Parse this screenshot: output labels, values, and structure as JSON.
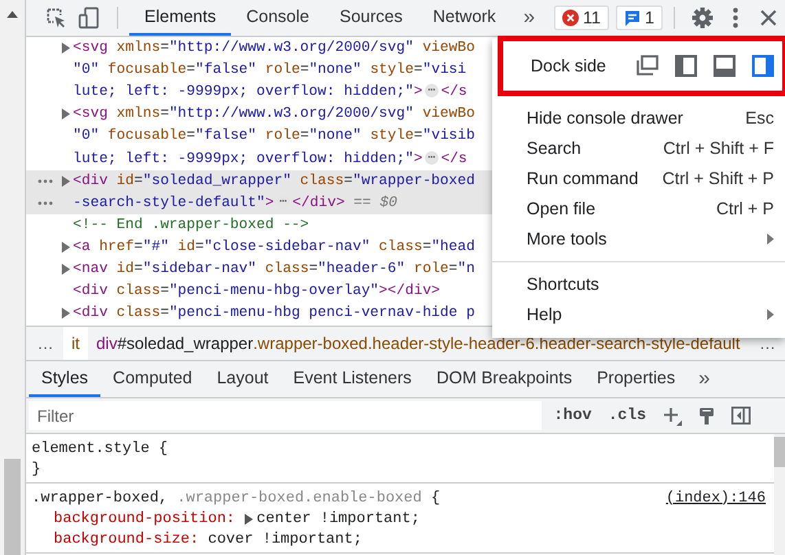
{
  "toolbar": {
    "tabs": [
      {
        "label": "Elements",
        "selected": true
      },
      {
        "label": "Console",
        "selected": false
      },
      {
        "label": "Sources",
        "selected": false
      },
      {
        "label": "Network",
        "selected": false
      }
    ],
    "overflow": "»",
    "errors": "11",
    "messages": "1"
  },
  "elements": {
    "lines": [
      {
        "expandable": true,
        "selected": false,
        "segments": [
          {
            "kind": "tag",
            "text": "<svg"
          },
          {
            "kind": "attr",
            "text": " xmlns"
          },
          {
            "kind": "punct",
            "text": "="
          },
          {
            "kind": "value",
            "text": "\"http://www.w3.org/2000/svg\""
          },
          {
            "kind": "attr",
            "text": " viewBo"
          }
        ]
      },
      {
        "expandable": false,
        "selected": false,
        "segments": [
          {
            "kind": "value",
            "text": "\"0\""
          },
          {
            "kind": "attr",
            "text": " focusable"
          },
          {
            "kind": "punct",
            "text": "="
          },
          {
            "kind": "value",
            "text": "\"false\""
          },
          {
            "kind": "attr",
            "text": " role"
          },
          {
            "kind": "punct",
            "text": "="
          },
          {
            "kind": "value",
            "text": "\"none\""
          },
          {
            "kind": "attr",
            "text": " style"
          },
          {
            "kind": "punct",
            "text": "="
          },
          {
            "kind": "value",
            "text": "\"visi"
          }
        ]
      },
      {
        "expandable": false,
        "selected": false,
        "segments": [
          {
            "kind": "value",
            "text": "lute; left: -9999px; overflow: hidden;\""
          },
          {
            "kind": "tag",
            "text": ">"
          },
          {
            "kind": "dots",
            "text": "⋯"
          },
          {
            "kind": "tag",
            "text": "</s"
          }
        ]
      },
      {
        "expandable": true,
        "selected": false,
        "segments": [
          {
            "kind": "tag",
            "text": "<svg"
          },
          {
            "kind": "attr",
            "text": " xmlns"
          },
          {
            "kind": "punct",
            "text": "="
          },
          {
            "kind": "value",
            "text": "\"http://www.w3.org/2000/svg\""
          },
          {
            "kind": "attr",
            "text": " viewBo"
          }
        ]
      },
      {
        "expandable": false,
        "selected": false,
        "segments": [
          {
            "kind": "value",
            "text": "\"0\""
          },
          {
            "kind": "attr",
            "text": " focusable"
          },
          {
            "kind": "punct",
            "text": "="
          },
          {
            "kind": "value",
            "text": "\"false\""
          },
          {
            "kind": "attr",
            "text": " role"
          },
          {
            "kind": "punct",
            "text": "="
          },
          {
            "kind": "value",
            "text": "\"none\""
          },
          {
            "kind": "attr",
            "text": " style"
          },
          {
            "kind": "punct",
            "text": "="
          },
          {
            "kind": "value",
            "text": "\"visib"
          }
        ]
      },
      {
        "expandable": false,
        "selected": false,
        "segments": [
          {
            "kind": "value",
            "text": "lute; left: -9999px; overflow: hidden;\""
          },
          {
            "kind": "tag",
            "text": ">"
          },
          {
            "kind": "dots",
            "text": "⋯"
          },
          {
            "kind": "tag",
            "text": "</s"
          }
        ]
      },
      {
        "expandable": true,
        "selected": true,
        "segments": [
          {
            "kind": "tag",
            "text": "<div"
          },
          {
            "kind": "attr",
            "text": " id"
          },
          {
            "kind": "punct",
            "text": "="
          },
          {
            "kind": "value",
            "text": "\"soledad_wrapper\""
          },
          {
            "kind": "attr",
            "text": " class"
          },
          {
            "kind": "punct",
            "text": "="
          },
          {
            "kind": "value",
            "text": "\"wrapper-boxed"
          }
        ]
      },
      {
        "expandable": false,
        "selected": true,
        "segments": [
          {
            "kind": "value",
            "text": "-search-style-default\""
          },
          {
            "kind": "tag",
            "text": ">"
          },
          {
            "kind": "dots",
            "text": "⋯"
          },
          {
            "kind": "tag",
            "text": "</div>"
          },
          {
            "kind": "note",
            "text": " == $0"
          }
        ]
      },
      {
        "expandable": false,
        "selected": false,
        "segments": [
          {
            "kind": "comment",
            "text": "<!-- End .wrapper-boxed -->"
          }
        ]
      },
      {
        "expandable": true,
        "selected": false,
        "segments": [
          {
            "kind": "tag",
            "text": "<a"
          },
          {
            "kind": "attr",
            "text": " href"
          },
          {
            "kind": "punct",
            "text": "="
          },
          {
            "kind": "value",
            "text": "\"#\""
          },
          {
            "kind": "attr",
            "text": " id"
          },
          {
            "kind": "punct",
            "text": "="
          },
          {
            "kind": "value",
            "text": "\"close-sidebar-nav\""
          },
          {
            "kind": "attr",
            "text": " class"
          },
          {
            "kind": "punct",
            "text": "="
          },
          {
            "kind": "value",
            "text": "\"head"
          }
        ]
      },
      {
        "expandable": true,
        "selected": false,
        "segments": [
          {
            "kind": "tag",
            "text": "<nav"
          },
          {
            "kind": "attr",
            "text": " id"
          },
          {
            "kind": "punct",
            "text": "="
          },
          {
            "kind": "value",
            "text": "\"sidebar-nav\""
          },
          {
            "kind": "attr",
            "text": " class"
          },
          {
            "kind": "punct",
            "text": "="
          },
          {
            "kind": "value",
            "text": "\"header-6\""
          },
          {
            "kind": "attr",
            "text": " role"
          },
          {
            "kind": "punct",
            "text": "="
          },
          {
            "kind": "value",
            "text": "\"n"
          }
        ]
      },
      {
        "expandable": false,
        "selected": false,
        "segments": [
          {
            "kind": "tag",
            "text": "<div"
          },
          {
            "kind": "attr",
            "text": " class"
          },
          {
            "kind": "punct",
            "text": "="
          },
          {
            "kind": "value",
            "text": "\"penci-menu-hbg-overlay\""
          },
          {
            "kind": "tag",
            "text": "></div>"
          }
        ]
      },
      {
        "expandable": true,
        "selected": false,
        "segments": [
          {
            "kind": "tag",
            "text": "<div"
          },
          {
            "kind": "attr",
            "text": " class"
          },
          {
            "kind": "punct",
            "text": "="
          },
          {
            "kind": "value",
            "text": "\"penci-menu-hbg penci-vernav-hide p"
          }
        ]
      }
    ]
  },
  "breadcrumbs": {
    "left": "…",
    "crumbs": [
      {
        "selected": true,
        "segments": [
          {
            "kind": "class",
            "text": "it"
          }
        ]
      },
      {
        "selected": false,
        "segments": [
          {
            "kind": "tag",
            "text": "div"
          },
          {
            "kind": "id",
            "text": "#soledad_wrapper"
          },
          {
            "kind": "class",
            "text": ".wrapper-boxed.header-style-header-6.header-search-style-default"
          }
        ]
      }
    ],
    "right": "…"
  },
  "sidebar_tabs": {
    "tabs": [
      {
        "label": "Styles",
        "selected": true
      },
      {
        "label": "Computed",
        "selected": false
      },
      {
        "label": "Layout",
        "selected": false
      },
      {
        "label": "Event Listeners",
        "selected": false
      },
      {
        "label": "DOM Breakpoints",
        "selected": false
      },
      {
        "label": "Properties",
        "selected": false
      }
    ],
    "overflow": "»"
  },
  "filter": {
    "placeholder": "Filter",
    "toggles": [
      ":hov",
      ".cls"
    ]
  },
  "styles": {
    "rules": [
      {
        "selector": [
          {
            "text": "element.style",
            "matched": true
          }
        ],
        "open": " {",
        "close": "}"
      },
      {
        "selector": [
          {
            "text": ".wrapper-boxed,",
            "matched": true
          },
          {
            "text": " .wrapper-boxed.enable-boxed",
            "matched": false
          }
        ],
        "open": " {",
        "source": "(index):146",
        "properties": [
          {
            "name": "background-position:",
            "value": "center !important;",
            "expandable": true
          },
          {
            "name": "background-size:",
            "value": "cover !important;",
            "expandable": false
          }
        ]
      }
    ]
  },
  "menu": {
    "dock_side": {
      "label": "Dock side",
      "options": [
        {
          "kind": "undock",
          "selected": false
        },
        {
          "kind": "left",
          "selected": false
        },
        {
          "kind": "bottom",
          "selected": false
        },
        {
          "kind": "right",
          "selected": true
        }
      ]
    },
    "groups": [
      [
        {
          "label": "Hide console drawer",
          "shortcut": "Esc",
          "submenu": false
        },
        {
          "label": "Search",
          "shortcut": "Ctrl + Shift + F",
          "submenu": false
        },
        {
          "label": "Run command",
          "shortcut": "Ctrl + Shift + P",
          "submenu": false
        },
        {
          "label": "Open file",
          "shortcut": "Ctrl + P",
          "submenu": false
        },
        {
          "label": "More tools",
          "submenu": true
        }
      ],
      [
        {
          "label": "Shortcuts",
          "submenu": false
        },
        {
          "label": "Help",
          "submenu": true
        }
      ]
    ]
  }
}
